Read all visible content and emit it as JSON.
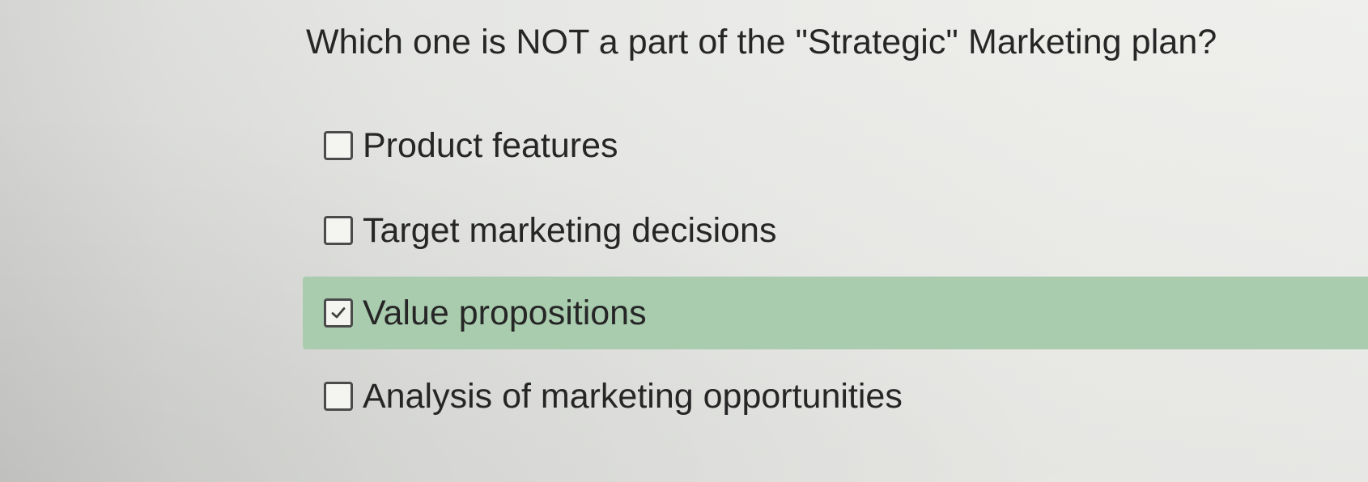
{
  "question": {
    "text": "Which one is NOT a part of the \"Strategic\" Marketing plan?"
  },
  "options": [
    {
      "label": "Product features",
      "checked": false
    },
    {
      "label": "Target marketing decisions",
      "checked": false
    },
    {
      "label": "Value propositions",
      "checked": true
    },
    {
      "label": "Analysis of marketing opportunities",
      "checked": false
    }
  ],
  "colors": {
    "selected_highlight": "#a9ccae",
    "text": "#262626",
    "checkbox_border": "#4b4b4b"
  },
  "icons": {
    "checked": "checkmark-icon"
  }
}
